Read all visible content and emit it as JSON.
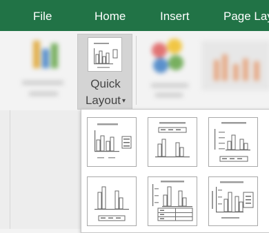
{
  "tabs": [
    {
      "label": "File"
    },
    {
      "label": "Home"
    },
    {
      "label": "Insert"
    },
    {
      "label": "Page Lay"
    }
  ],
  "quick_layout": {
    "line1": "Quick",
    "line2": "Layout",
    "caret": "▾"
  },
  "gallery": {
    "layouts": [
      {
        "layout": "title-legend-right"
      },
      {
        "layout": "title-legend-top"
      },
      {
        "layout": "title-axes-legend-bottom"
      },
      {
        "layout": "legend-bottom-no-title"
      },
      {
        "layout": "title-data-table"
      },
      {
        "layout": "title-axes-legend-right"
      }
    ]
  },
  "colors": {
    "tab_green": "#217346",
    "ribbon_bg": "#f3f3f3",
    "selected_button": "#d4d4d4"
  }
}
